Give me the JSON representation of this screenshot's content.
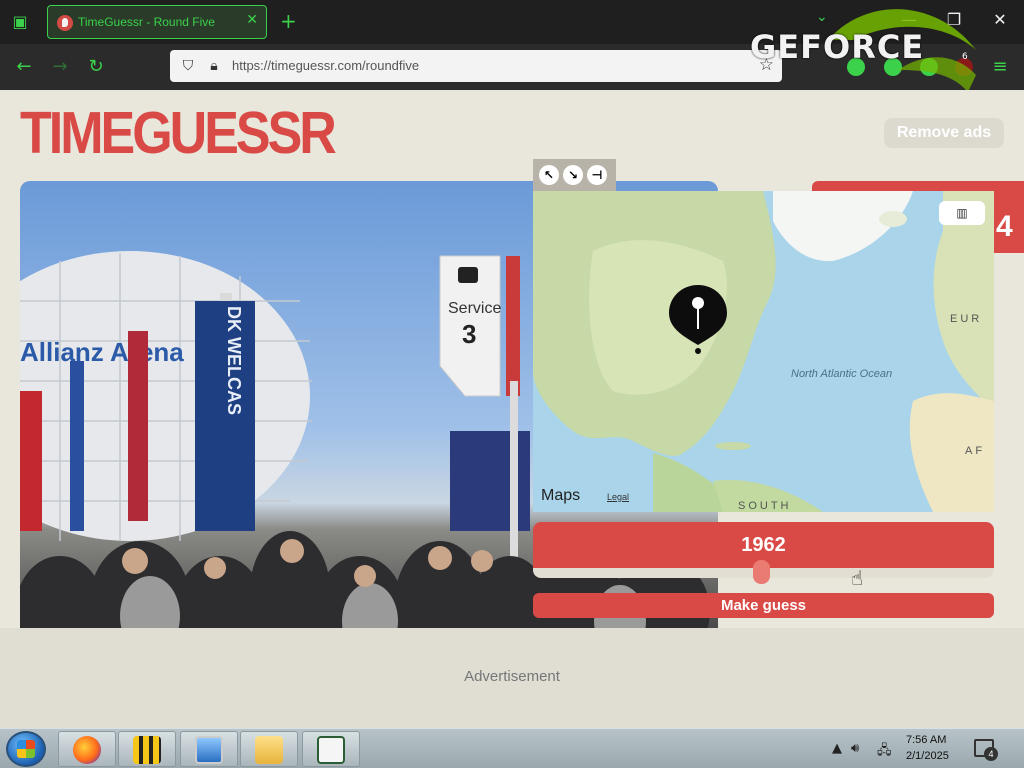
{
  "browser": {
    "tab_title": "TimeGuessr - Round Five",
    "new_tab_glyph": "+",
    "url": "https://timeguessr.com/roundfive",
    "url_display": "https://timeguessr.com/roundfive",
    "extension_badge": "6",
    "accent_color": "#3bd14b"
  },
  "overlay": {
    "brand": "GEFORCE"
  },
  "page": {
    "logo": "TIMEGUESSR",
    "remove_ads_label": "Remove ads",
    "round_number": "4",
    "brand_color": "#d94a46"
  },
  "photo": {
    "sign_service_label": "Service",
    "sign_service_number": "3",
    "banner_text": "DK WELCAS",
    "stadium_text": "Allianz Arena"
  },
  "map": {
    "ocean_label": "North Atlantic Ocean",
    "region_eur": "EUR",
    "region_af": "AF",
    "region_south": "SOUTH",
    "provider": "Maps",
    "legal_label": "Legal",
    "map_type_icon": "map-icon"
  },
  "guess": {
    "year": "1962",
    "slider_value_fraction": 0.5,
    "make_guess_label": "Make guess"
  },
  "ad": {
    "label": "Advertisement"
  },
  "taskbar": {
    "time": "7:56 AM",
    "date": "2/1/2025",
    "notification_count": "4"
  }
}
